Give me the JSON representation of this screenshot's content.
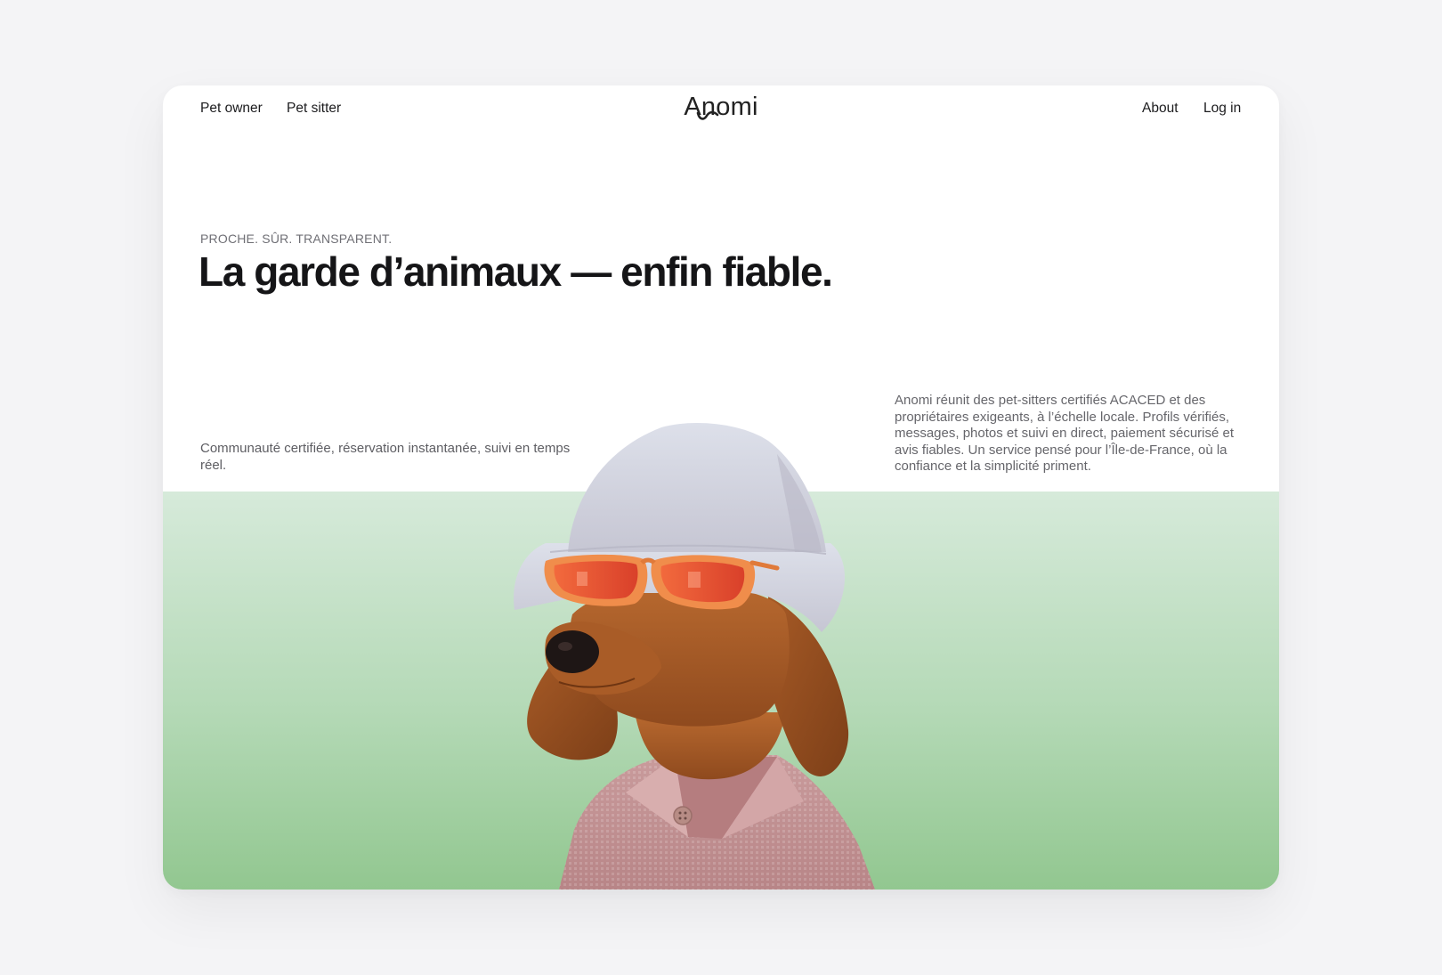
{
  "nav": {
    "left": [
      "Pet owner",
      "Pet sitter"
    ],
    "right": [
      "About",
      "Log in"
    ]
  },
  "brand": {
    "logo_text": "Anomi"
  },
  "hero": {
    "eyebrow": "PROCHE. SÛR. TRANSPARENT.",
    "headline": "La garde d’animaux — enfin fiable.",
    "lead_left": "Communauté certifiée, réservation instantanée, suivi en temps réel.",
    "lead_right": "Anomi réunit des pet-sitters certifiés ACACED et des propriétaires exigeants, à l’échelle locale. Profils vérifiés, messages, photos et suivi en direct, paiement sécurisé et avis fiables. Un service pensé pour l’Île-de-France, où la confiance et la simplicité priment."
  },
  "colors": {
    "page_bg": "#f4f4f6",
    "card_bg": "#ffffff",
    "band_top": "#d6eada",
    "band_bottom": "#92c790",
    "text_dark": "#151517",
    "text_muted": "#66666b"
  }
}
